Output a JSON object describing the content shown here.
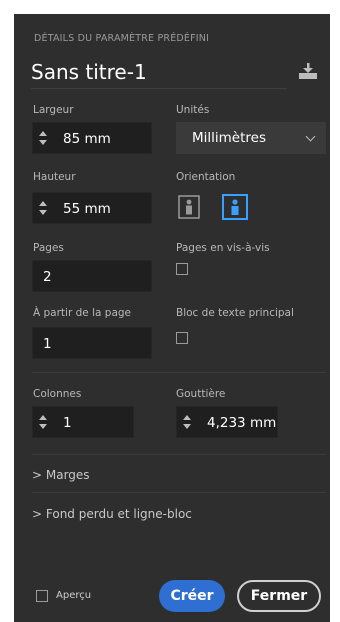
{
  "section_title": "DÉTAILS DU PARAMÈTRE PRÉDÉFINI",
  "document_name": "Sans titre-1",
  "save_icon": "save-preset-icon",
  "width": {
    "label": "Largeur",
    "value": "85 mm"
  },
  "units": {
    "label": "Unités",
    "value": "Millimètres"
  },
  "height": {
    "label": "Hauteur",
    "value": "55 mm"
  },
  "orientation": {
    "label": "Orientation",
    "selected": "landscape"
  },
  "pages": {
    "label": "Pages",
    "value": "2"
  },
  "facing_pages": {
    "label": "Pages en vis-à-vis",
    "checked": false
  },
  "start_page": {
    "label": "À partir de la page",
    "value": "1"
  },
  "primary_text_frame": {
    "label": "Bloc de texte principal",
    "checked": false
  },
  "columns": {
    "label": "Colonnes",
    "value": "1"
  },
  "gutter": {
    "label": "Gouttière",
    "value": "4,233 mm"
  },
  "margins_label": "Marges",
  "bleed_label": "Fond perdu et ligne-bloc",
  "preview": {
    "label": "Aperçu",
    "checked": false
  },
  "buttons": {
    "create": "Créer",
    "close": "Fermer"
  },
  "colors": {
    "accent": "#2f6fd1",
    "panel": "#2e2e2e",
    "orientation_selected": "#3aa0ff"
  }
}
